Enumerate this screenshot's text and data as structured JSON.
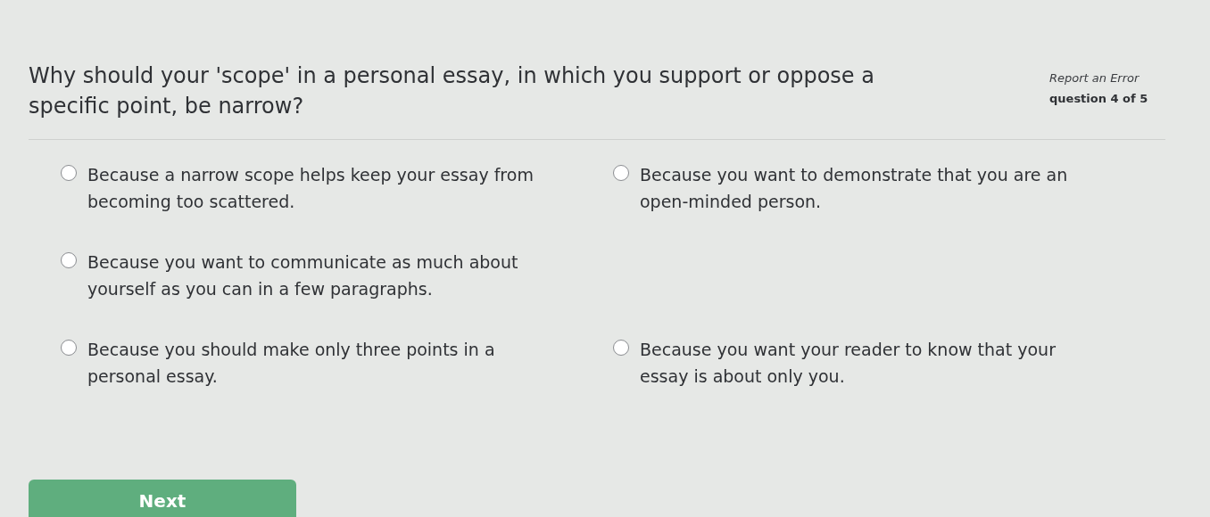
{
  "question": "Why should your 'scope' in a personal essay, in which you support or oppose a specific point, be narrow?",
  "report_link": "Report an Error",
  "progress": "question 4 of 5",
  "option_rows": [
    [
      {
        "text": "Because a narrow scope helps keep your essay from becoming too scattered.",
        "selected": false
      },
      {
        "text": "Because you want to demonstrate that you are an open-minded person.",
        "selected": false
      }
    ],
    [
      {
        "text": "Because you want to communicate as much about yourself as you can in a few paragraphs.",
        "selected": false
      }
    ],
    [
      {
        "text": "Because you should make only three points in a personal essay.",
        "selected": false
      },
      {
        "text": "Because you want your reader to know that your essay is about only you.",
        "selected": false
      }
    ]
  ],
  "next_button": "Next"
}
